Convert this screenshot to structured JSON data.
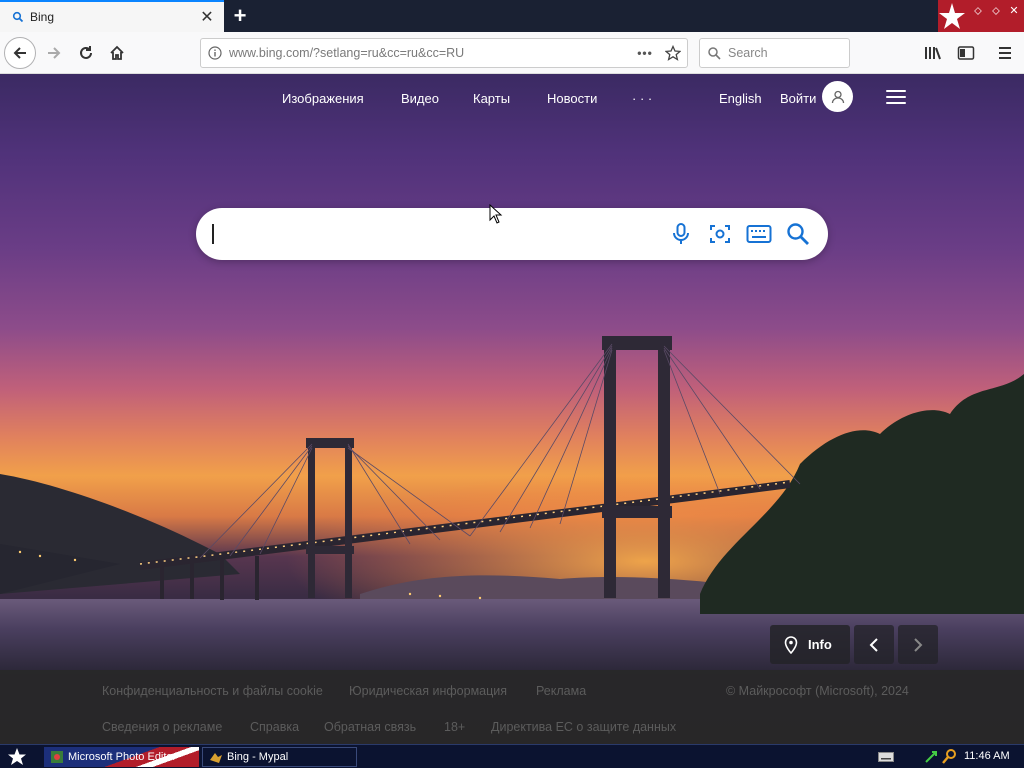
{
  "browser": {
    "tab_title": "Bing",
    "url": "www.bing.com/?setlang=ru&cc=ru&cc=RU",
    "search_placeholder": "Search"
  },
  "bing": {
    "nav": [
      "Изображения",
      "Видео",
      "Карты",
      "Новости",
      "· · ·"
    ],
    "language": "English",
    "signin": "Войти",
    "info_label": "Info"
  },
  "footer": {
    "row1": [
      "Конфиденциальность и файлы cookie",
      "Юридическая информация",
      "Реклама"
    ],
    "copyright": "© Майкрософт (Microsoft), 2024",
    "row2": [
      "Сведения о рекламе",
      "Справка",
      "Обратная связь",
      "18+",
      "Директива ЕС о защите данных"
    ]
  },
  "taskbar": {
    "items": [
      "Microsoft Photo Editor",
      "Bing - Mypal"
    ],
    "clock": "11:46 AM"
  },
  "colors": {
    "accent": "#0a84ff",
    "bing_icon": "#1672d4",
    "taskbar": "#0b1330",
    "wm_red": "#b21d2a"
  }
}
